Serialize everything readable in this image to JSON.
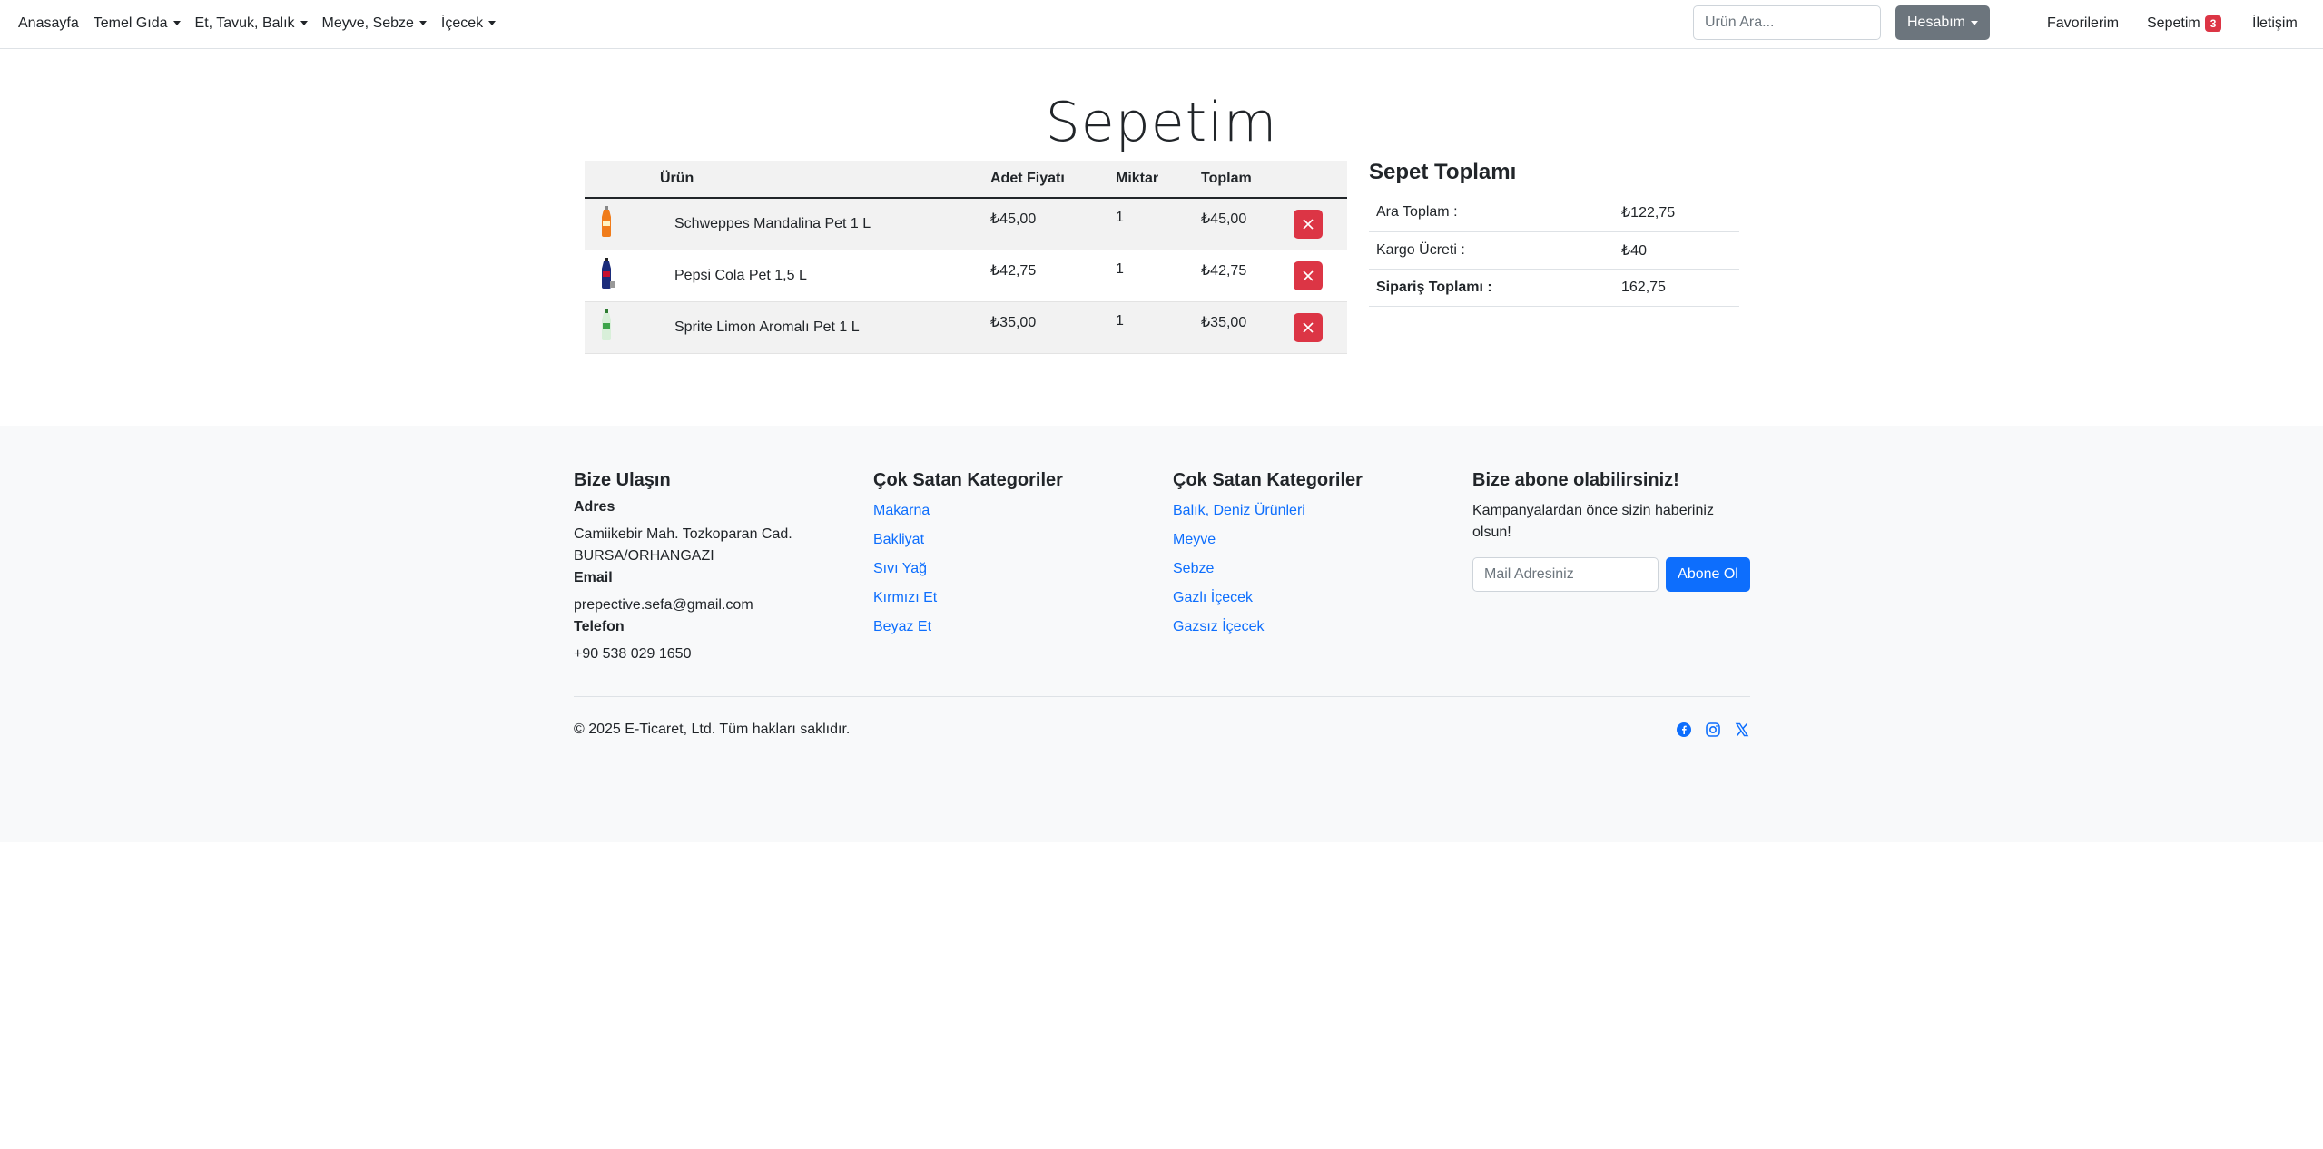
{
  "nav": {
    "home": "Anasayfa",
    "menus": [
      "Temel Gıda",
      "Et, Tavuk, Balık",
      "Meyve, Sebze",
      "İçecek"
    ],
    "search_placeholder": "Ürün Ara...",
    "account": "Hesabım",
    "favorites": "Favorilerim",
    "cart": "Sepetim",
    "cart_count": "3",
    "contact": "İletişim"
  },
  "page_title": "Sepetim",
  "cart": {
    "headers": [
      "Ürün",
      "Adet Fiyatı",
      "Miktar",
      "Toplam"
    ],
    "items": [
      {
        "name": "Schweppes Mandalina Pet 1 L",
        "price": "₺45,00",
        "qty": "1",
        "total": "₺45,00",
        "bottle_color": "#f07c1b"
      },
      {
        "name": "Pepsi Cola Pet 1,5 L",
        "price": "₺42,75",
        "qty": "1",
        "total": "₺42,75",
        "bottle_color": "#1c2c7a"
      },
      {
        "name": "Sprite Limon Aromalı Pet 1 L",
        "price": "₺35,00",
        "qty": "1",
        "total": "₺35,00",
        "bottle_color": "#3ca54a"
      }
    ]
  },
  "summary": {
    "title": "Sepet Toplamı",
    "subtotal_label": "Ara Toplam :",
    "subtotal": "₺122,75",
    "shipping_label": "Kargo Ücreti :",
    "shipping": "₺40",
    "total_label": "Sipariş Toplamı :",
    "total": "162,75"
  },
  "footer": {
    "contact": {
      "title": "Bize Ulaşın",
      "address_label": "Adres",
      "address_line1": "Camiikebir Mah. Tozkoparan Cad.",
      "address_line2": "BURSA/ORHANGAZI",
      "email_label": "Email",
      "email": "prepective.sefa@gmail.com",
      "phone_label": "Telefon",
      "phone": "+90 538 029 1650"
    },
    "categories1": {
      "title": "Çok Satan Kategoriler",
      "links": [
        "Makarna",
        "Bakliyat",
        "Sıvı Yağ",
        "Kırmızı Et",
        "Beyaz Et"
      ]
    },
    "categories2": {
      "title": "Çok Satan Kategoriler",
      "links": [
        "Balık, Deniz Ürünleri",
        "Meyve",
        "Sebze",
        "Gazlı İçecek",
        "Gazsız İçecek"
      ]
    },
    "subscribe": {
      "title": "Bize abone olabilirsiniz!",
      "text": "Kampanyalardan önce sizin haberiniz olsun!",
      "placeholder": "Mail Adresiniz",
      "button": "Abone Ol"
    },
    "copyright": "© 2025 E-Ticaret, Ltd. Tüm hakları saklıdır.",
    "social_icons": [
      "facebook-icon",
      "instagram-icon",
      "x-icon"
    ],
    "link_color": "#0d6efd"
  }
}
